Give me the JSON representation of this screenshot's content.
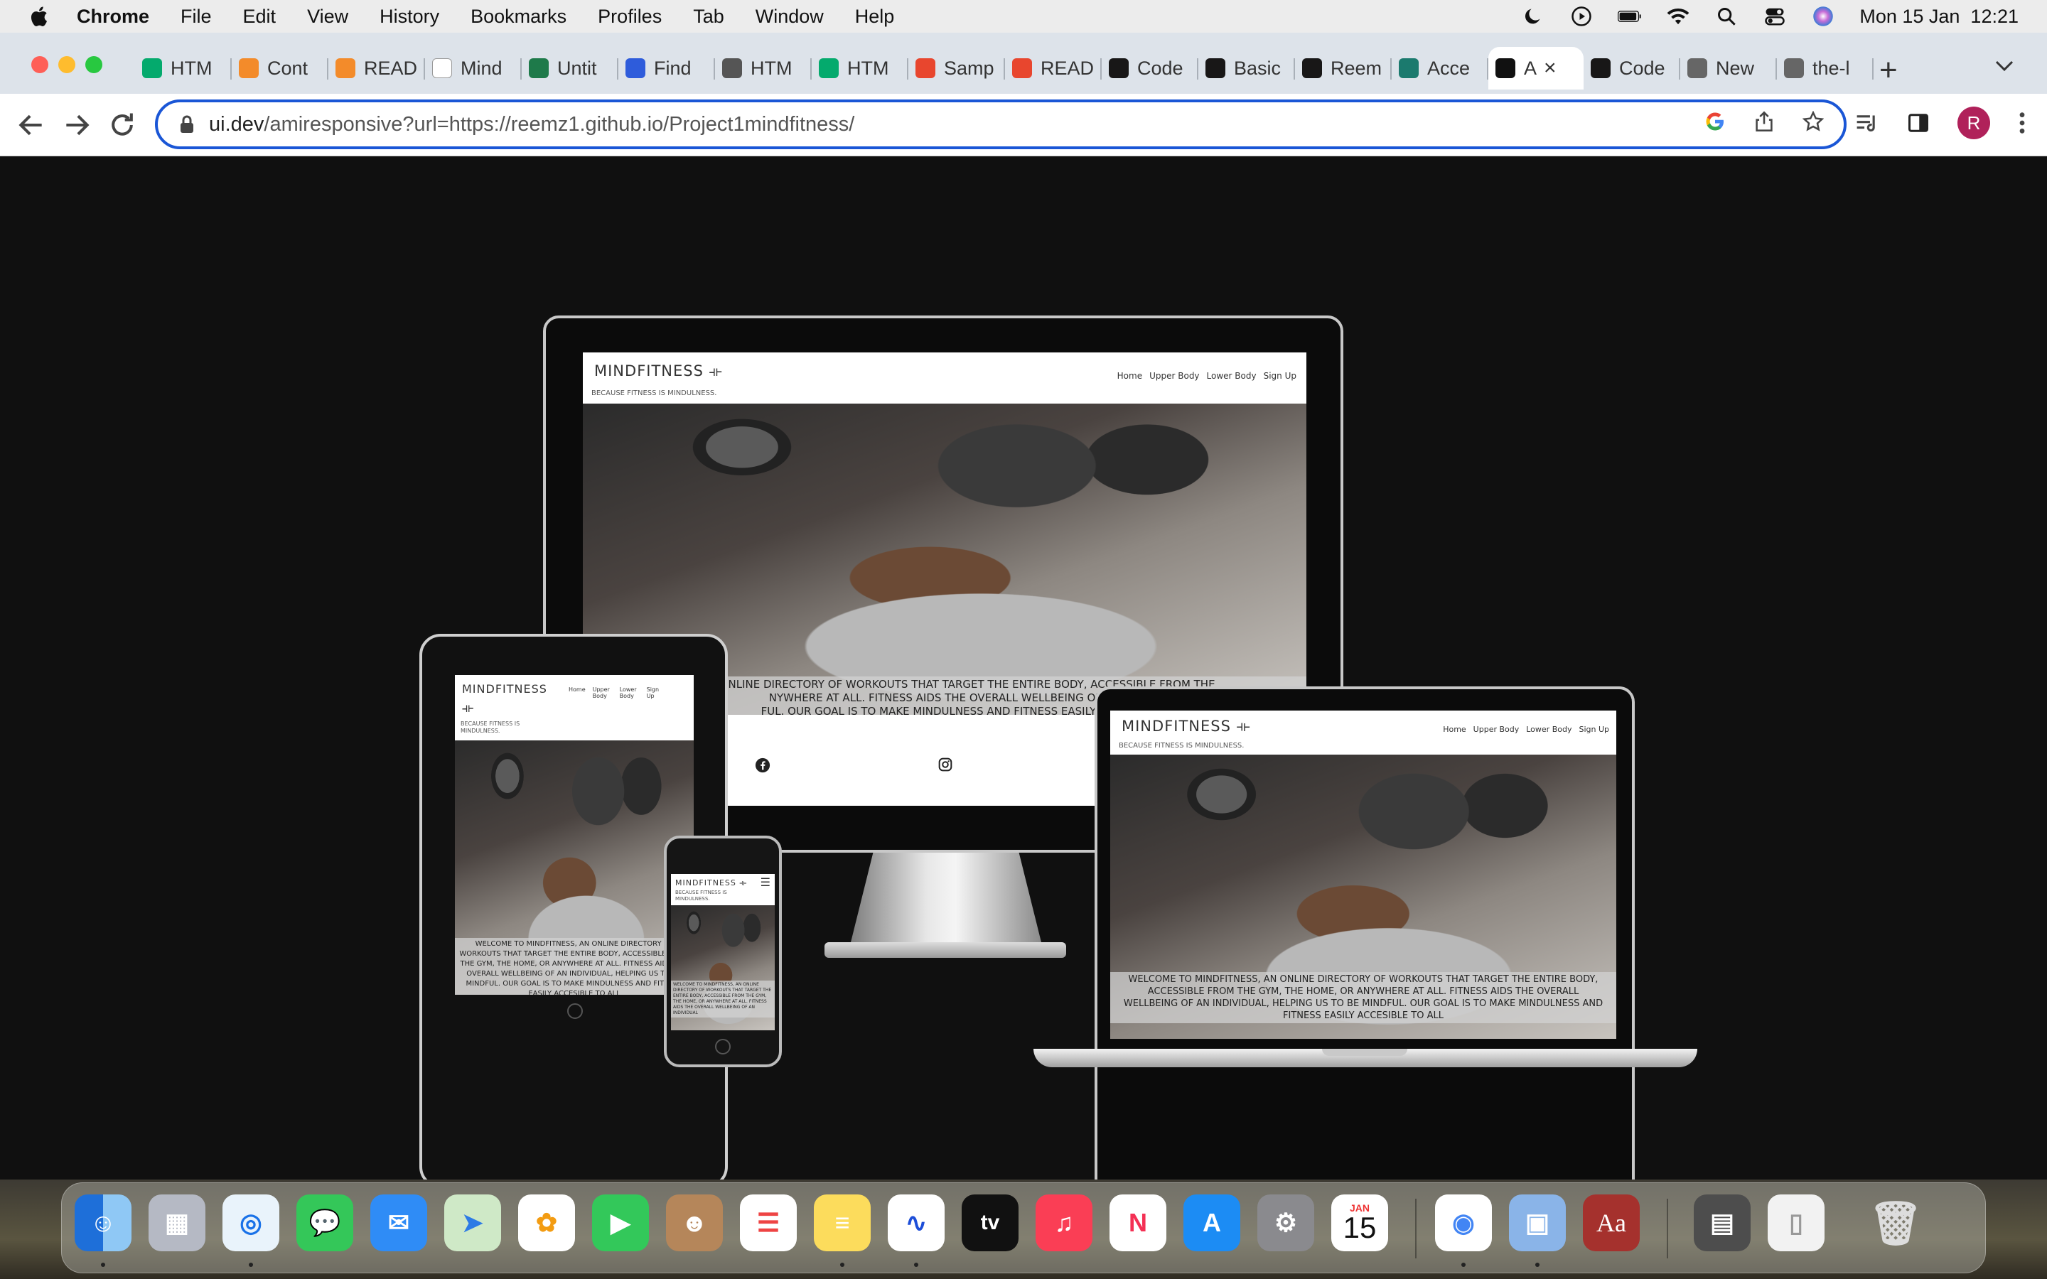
{
  "menubar": {
    "app_name": "Chrome",
    "menus": [
      "File",
      "Edit",
      "View",
      "History",
      "Bookmarks",
      "Profiles",
      "Tab",
      "Window",
      "Help"
    ],
    "clock": "Mon 15 Jan  12:21"
  },
  "browser": {
    "tabs": [
      {
        "label": "HTM",
        "icon": "w3schools-icon",
        "color": "#04aa6d"
      },
      {
        "label": "Cont",
        "icon": "grammarly-icon",
        "color": "#f38b2a"
      },
      {
        "label": "READ",
        "icon": "grammarly-icon",
        "color": "#f38b2a"
      },
      {
        "label": "Mind",
        "icon": "document-icon",
        "color": "#ffffff"
      },
      {
        "label": "Untit",
        "icon": "d-icon",
        "color": "#1e7a4a"
      },
      {
        "label": "Find",
        "icon": "flag-icon",
        "color": "#2e5cdb"
      },
      {
        "label": "HTM",
        "icon": "dark-circle-icon",
        "color": "#555555"
      },
      {
        "label": "HTM",
        "icon": "w3schools-icon",
        "color": "#04aa6d"
      },
      {
        "label": "Samp",
        "icon": "red-circle-icon",
        "color": "#e8462e"
      },
      {
        "label": "READ",
        "icon": "red-circle-icon",
        "color": "#e8462e"
      },
      {
        "label": "Code",
        "icon": "github-icon",
        "color": "#181717"
      },
      {
        "label": "Basic",
        "icon": "github-icon",
        "color": "#181717"
      },
      {
        "label": "Reem",
        "icon": "github-icon",
        "color": "#181717"
      },
      {
        "label": "Acce",
        "icon": "a11y-icon",
        "color": "#1b7a6e"
      },
      {
        "label": "A",
        "icon": "ui-dev-icon",
        "color": "#111111",
        "active": true
      },
      {
        "label": "Code",
        "icon": "github-icon",
        "color": "#181717"
      },
      {
        "label": "New",
        "icon": "chrome-icon",
        "color": "#666666"
      },
      {
        "label": "the-l",
        "icon": "globe-icon",
        "color": "#666666"
      }
    ],
    "url_host": "ui.dev",
    "url_path": "/amiresponsive?url=https://reemz1.github.io/Project1mindfitness/",
    "profile_initial": "R"
  },
  "site": {
    "brand": "MINDFITNESS",
    "tagline": "BECAUSE FITNESS IS MINDULNESS.",
    "nav": [
      "Home",
      "Upper Body",
      "Lower Body",
      "Sign Up"
    ],
    "hero_text": "WELCOME TO MINDFITNESS, AN ONLINE DIRECTORY OF WORKOUTS THAT TARGET THE ENTIRE BODY, ACCESSIBLE FROM THE GYM, THE HOME, OR ANYWHERE AT ALL. FITNESS AIDS THE OVERALL WELLBEING OF AN INDIVIDUAL, HELPING US TO BE MINDFUL. OUR GOAL IS TO MAKE MINDULNESS AND FITNESS EASILY ACCESIBLE TO ALL",
    "desktop_hero_line1": "ESS, AN ONLINE DIRECTORY OF WORKOUTS THAT TARGET THE ENTIRE BODY, ACCESSIBLE FROM THE",
    "desktop_hero_line2": "NYWHERE AT ALL. FITNESS AIDS THE OVERALL WELLBEING OF AN",
    "desktop_hero_line3": "FUL. OUR GOAL IS TO MAKE MINDULNESS AND FITNESS EASILY ACCE",
    "laptop_hero_line1": "WELCOME TO MINDFITNESS, AN ONLINE DIRECTORY OF WORKOUTS THAT TARGET THE ENTIRE BODY,",
    "laptop_hero_line2": "ACCESSIBLE FROM THE GYM, THE HOME, OR ANYWHERE AT ALL. FITNESS AIDS THE OVERALL",
    "laptop_hero_line3": "WELLBEING OF AN INDIVIDUAL, HELPING US TO BE MINDFUL. OUR GOAL IS TO MAKE MINDULNESS AND",
    "laptop_hero_line4": "FITNESS EASILY ACCESIBLE TO ALL",
    "tablet_brand": "MINDFITNESS",
    "tablet_tagline": "BECAUSE FITNESS IS MINDULNESS.",
    "tablet_nav": [
      "Home",
      "Upper Body",
      "Lower Body",
      "Sign Up"
    ],
    "tablet_hero_text": "WELCOME TO MINDFITNESS, AN ONLINE DIRECTORY OF WORKOUTS THAT TARGET THE ENTIRE BODY, ACCESSIBLE FROM THE GYM, THE HOME, OR ANYWHERE AT ALL. FITNESS AIDS THE OVERALL WELLBEING OF AN INDIVIDUAL, HELPING US TO BE MINDFUL. OUR GOAL IS TO MAKE MINDULNESS AND FITNESS EASILY ACCESIBLE TO ALL",
    "phone_brand": "MINDFITNESS",
    "phone_tagline": "BECAUSE FITNESS IS MINDULNESS.",
    "phone_hero_text": "WELCOME TO MINDFITNESS, AN ONLINE DIRECTORY OF WORKOUTS THAT TARGET THE ENTIRE BODY, ACCESSIBLE FROM THE GYM, THE HOME, OR ANYWHERE AT ALL. FITNESS AIDS THE OVERALL WELLBEING OF AN INDIVIDUAL"
  },
  "dock": {
    "calendar_month": "JAN",
    "calendar_day": "15",
    "dictionary_label": "Aa",
    "tv_label": "tv"
  }
}
